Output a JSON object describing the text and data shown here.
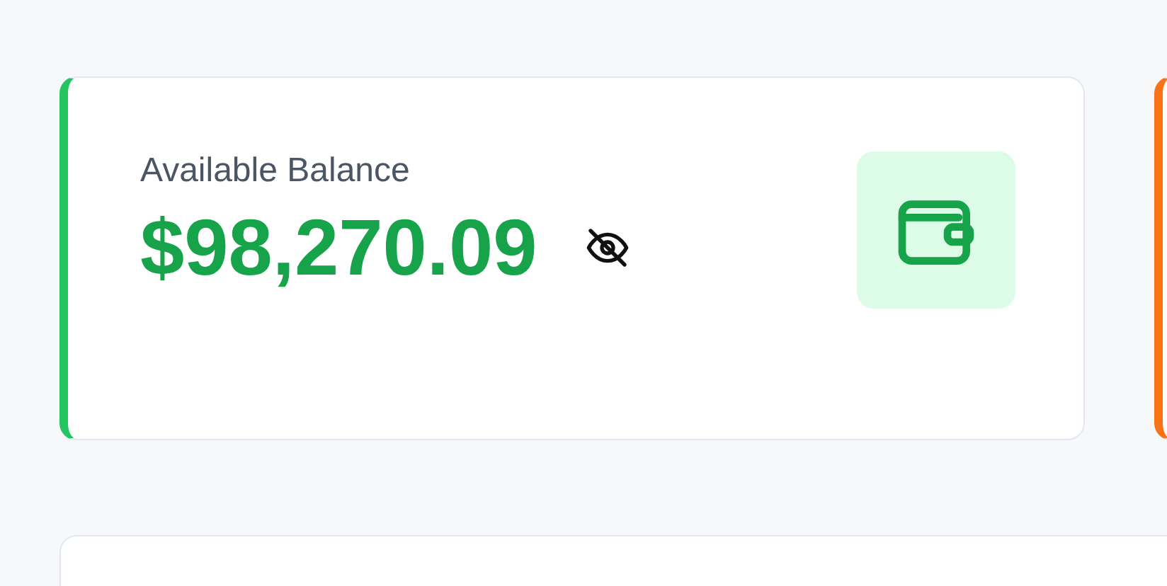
{
  "cards": [
    {
      "label": "Available Balance",
      "amount": "$98,270.09",
      "color": "#22c55e"
    },
    {
      "color": "#f97316"
    }
  ]
}
